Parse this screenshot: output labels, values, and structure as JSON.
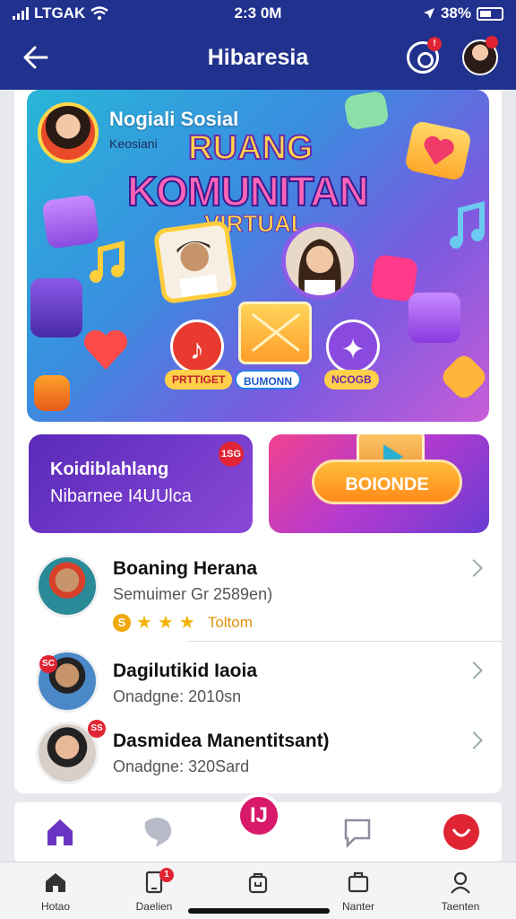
{
  "status_bar": {
    "carrier": "LTGAK",
    "time": "2:3 0M",
    "battery_text": "38%"
  },
  "header": {
    "title": "Hibaresia",
    "back_icon": "arrow-left-icon",
    "notification_badge": "!"
  },
  "hero": {
    "profile_name": "Nogiali Sosial",
    "profile_sub": "Keosiani",
    "title_line1": "RUANG",
    "title_line2": "KOMUNITAN",
    "title_line3": "VIRTUAL",
    "buttons": [
      {
        "label": "PRTTIGET",
        "color": "#e83a2e"
      },
      {
        "label": "BUMONN",
        "color": "#2a7ee8"
      },
      {
        "label": "NCOGB",
        "color": "#8a4ae0"
      }
    ]
  },
  "cards": {
    "left_line1": "Koidiblahlang",
    "left_line2": "Nibarnee I4UUlca",
    "left_badge": "1SG",
    "cta_label": "BOIONDE"
  },
  "list": [
    {
      "name": "Boaning Herana",
      "sub": "Semuimer Gr 2589en)",
      "rating_label": "Toltom",
      "rating_coin": "S",
      "stars": 3
    },
    {
      "name": "Dagilutikid Iaoia",
      "sub": "Onadgne: 2010sn",
      "badge": "SC"
    },
    {
      "name": "Dasmidea Manentitsant)",
      "sub": "Onadgne: 320Sard",
      "badge": "SS"
    }
  ],
  "action_bar": {
    "fab_label": "IJ"
  },
  "tabbar": [
    {
      "label": "Hotao",
      "icon": "home-icon"
    },
    {
      "label": "Daelien",
      "icon": "mobile-icon",
      "badge": "1"
    },
    {
      "label": "",
      "icon": "bag-icon"
    },
    {
      "label": "Nanter",
      "icon": "briefcase-icon"
    },
    {
      "label": "Taenten",
      "icon": "person-icon"
    }
  ],
  "colors": {
    "header": "#21318e",
    "accent_purple": "#6a35c4",
    "accent_pink": "#d8196a",
    "badge_red": "#e02434"
  }
}
